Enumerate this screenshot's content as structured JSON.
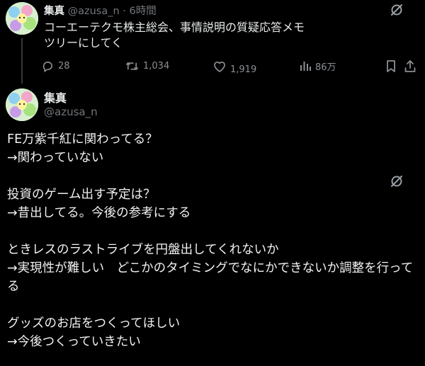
{
  "tweet1": {
    "author_name": "集真",
    "author_handle": "@azusa_n",
    "separator": "·",
    "time": "6時間",
    "text_lines": [
      "コーエーテクモ株主総会、事情説明の質疑応答メモ",
      "ツリーにしてく"
    ],
    "actions": {
      "reply_count": "28",
      "retweet_count": "1,034",
      "like_count": "1,919",
      "view_count": "86万"
    }
  },
  "tweet2": {
    "author_name": "集真",
    "author_handle": "@azusa_n",
    "text_lines": [
      "FE万紫千紅に関わってる？",
      "→関わっていない",
      "",
      "投資のゲーム出す予定は？",
      "→昔出してる。今後の参考にする",
      "",
      "ときレスのラストライブを円盤出してくれないか",
      "→実現性が難しい　どこかのタイミングでなにかできないか調整を行って",
      "る",
      "",
      "グッズのお店をつくってほしい",
      "→今後つくっていきたい"
    ]
  },
  "icons": {
    "grok": "grok-icon",
    "reply": "reply-icon",
    "retweet": "retweet-icon",
    "like": "heart-icon",
    "views": "views-icon",
    "bookmark": "bookmark-icon",
    "share": "share-icon"
  },
  "colors": {
    "background": "#000000",
    "text_primary": "#e7e9ea",
    "text_secondary": "#71767b",
    "thread_line": "#333639"
  }
}
